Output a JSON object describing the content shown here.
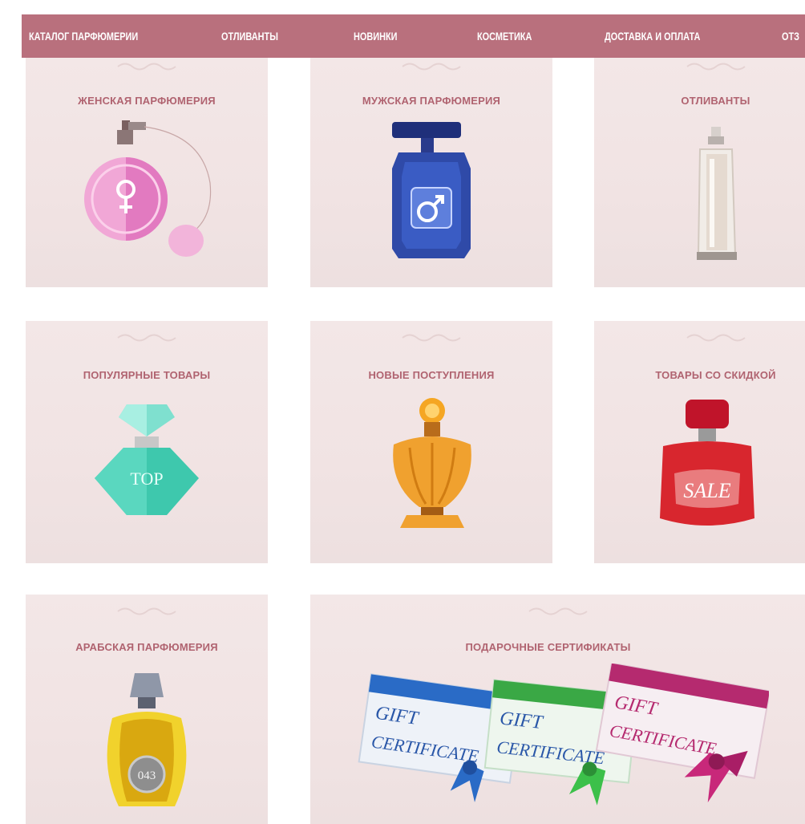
{
  "nav": {
    "items": [
      {
        "label": "КАТАЛОГ ПАРФЮМЕРИИ"
      },
      {
        "label": "ОТЛИВАНТЫ"
      },
      {
        "label": "НОВИНКИ"
      },
      {
        "label": "КОСМЕТИКА"
      },
      {
        "label": "ДОСТАВКА И ОПЛАТА"
      },
      {
        "label": "ОТЗ"
      }
    ]
  },
  "categories": [
    {
      "title": "ЖЕНСКАЯ ПАРФЮМЕРИЯ"
    },
    {
      "title": "МУЖСКАЯ ПАРФЮМЕРИЯ"
    },
    {
      "title": "ОТЛИВАНТЫ"
    },
    {
      "title": "ПОПУЛЯРНЫЕ ТОВАРЫ",
      "bottle_text": "TOP"
    },
    {
      "title": "НОВЫЕ ПОСТУПЛЕНИЯ"
    },
    {
      "title": "ТОВАРЫ СО СКИДКОЙ",
      "bottle_text": "SALE"
    },
    {
      "title": "АРАБСКАЯ ПАРФЮМЕРИЯ",
      "bottle_text": "043"
    },
    {
      "title": "ПОДАРОЧНЫЕ СЕРТИФИКАТЫ",
      "cert_line1": "GIFT",
      "cert_line2": "CERTIFICATE"
    }
  ],
  "colors": {
    "nav_bg": "#b9707d",
    "card_bg": "#f2e5e5",
    "title_color": "#b06370",
    "female_pink": "#e98fc8",
    "male_blue": "#2f4aa8",
    "top_teal": "#3ec8ad",
    "new_orange": "#f0a12f",
    "sale_red": "#d8262e",
    "cert_blue": "#2a6bc6",
    "cert_green": "#3aa845",
    "cert_magenta": "#b52a6f"
  }
}
